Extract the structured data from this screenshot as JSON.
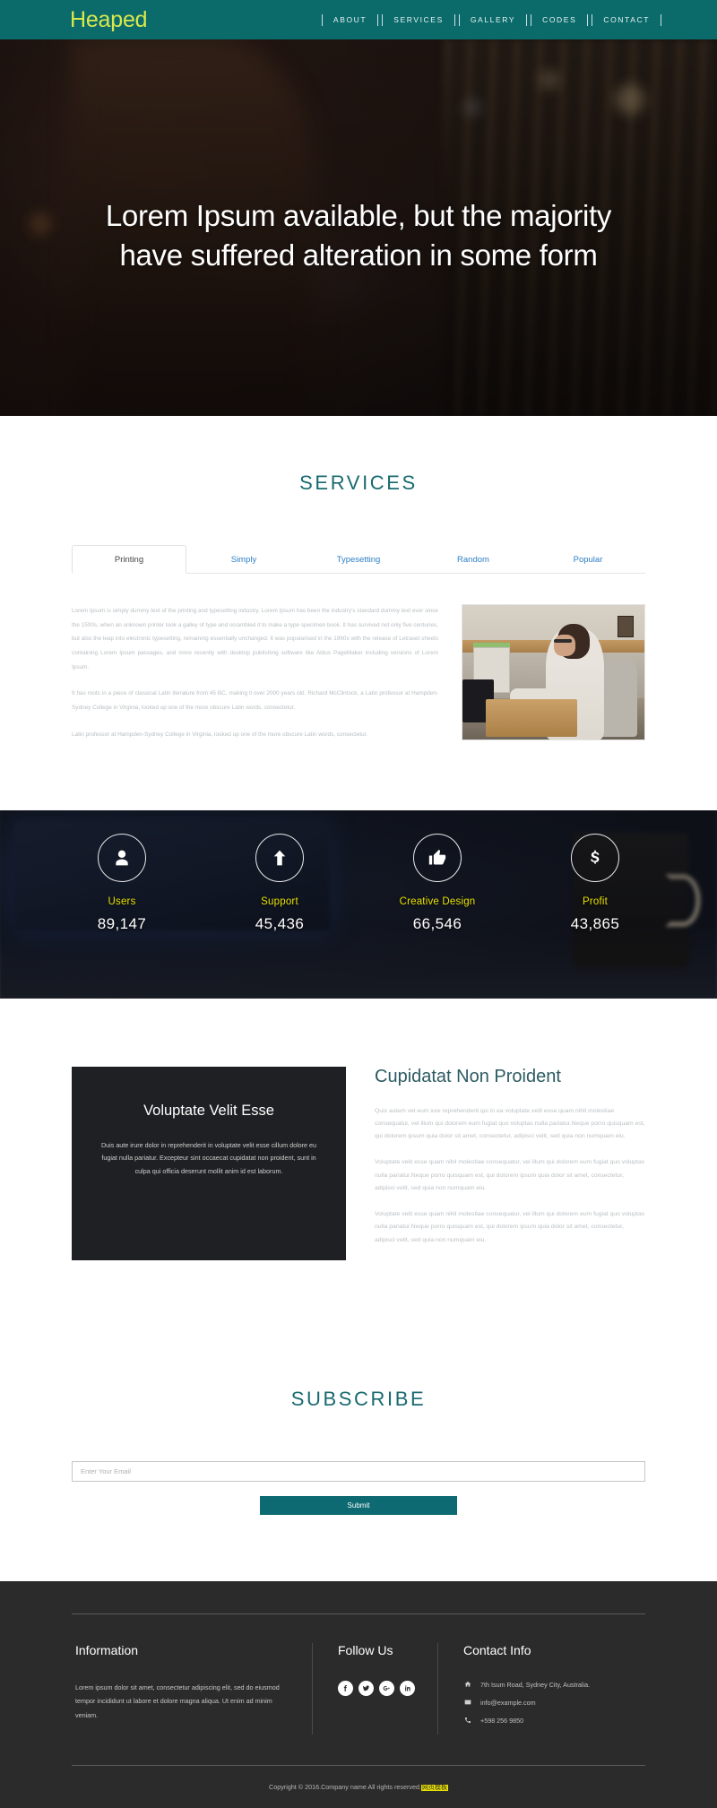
{
  "header": {
    "logo": "Heaped",
    "nav": [
      {
        "label": "ABOUT"
      },
      {
        "label": "SERVICES"
      },
      {
        "label": "GALLERY"
      },
      {
        "label": "CODES"
      },
      {
        "label": "CONTACT"
      }
    ]
  },
  "hero": {
    "title_line1": "Lorem Ipsum available, but the majority",
    "title_line2": "have suffered alteration in some form"
  },
  "services": {
    "title": "SERVICES",
    "tabs": [
      {
        "label": "Printing",
        "active": true
      },
      {
        "label": "Simply",
        "active": false
      },
      {
        "label": "Typesetting",
        "active": false
      },
      {
        "label": "Random",
        "active": false
      },
      {
        "label": "Popular",
        "active": false
      }
    ],
    "paragraphs": [
      "Lorem Ipsum is simply dummy text of the printing and typesetting industry. Lorem Ipsum has been the industry's standard dummy text ever since the 1500s, when an unknown printer took a galley of type and scrambled it to make a type specimen book. It has survived not only five centuries, but also the leap into electronic typesetting, remaining essentially unchanged. It was popularised in the 1960s with the release of Letraset sheets containing Lorem Ipsum passages, and more recently with desktop publishing software like Aldus PageMaker including versions of Lorem Ipsum.",
      "It has roots in a piece of classical Latin literature from 45 BC, making it over 2000 years old. Richard McClintock, a Latin professor at Hampden-Sydney College in Virginia, looked up one of the more obscure Latin words, consectetur.",
      "Latin professor at Hampden-Sydney College in Virginia, looked up one of the more obscure Latin words, consectetur."
    ],
    "image_alt": "man-at-desk-photo"
  },
  "stats": [
    {
      "icon": "user-icon",
      "label": "Users",
      "value": "89,147"
    },
    {
      "icon": "arrow-up-icon",
      "label": "Support",
      "value": "45,436"
    },
    {
      "icon": "thumbs-up-icon",
      "label": "Creative Design",
      "value": "66,546"
    },
    {
      "icon": "dollar-icon",
      "label": "Profit",
      "value": "43,865"
    }
  ],
  "about": {
    "card_title": "Voluptate Velit Esse",
    "card_text": "Duis aute irure dolor in reprehenderit in voluptate velit esse cillum dolore eu fugiat nulla pariatur. Excepteur sint occaecat cupidatat non proident, sunt in culpa qui officia deserunt mollit anim id est laborum.",
    "heading": "Cupidatat Non Proident",
    "paragraphs": [
      "Quis autem vel eum iure reprehenderit qui in ea voluptate velit esse quam nihil molestiae consequatur, vel illum qui dolorem eum fugiat quo voluptas nulla pariatur.Neque porro quisquam est, qui dolorem ipsum quia dolor sit amet, consectetur, adipisci velit, sed quia non numquam eiu.",
      "Voluptate velit esse quam nihil molestiae consequatur, vel illum qui dolorem eum fugiat quo voluptas nulla pariatur.Neque porro quisquam est, qui dolorem ipsum quia dolor sit amet, consectetur, adipisci velit, sed quia non numquam eiu.",
      "Voluptate velit esse quam nihil molestiae consequatur, vel illum qui dolorem eum fugiat quo voluptas nulla pariatur.Neque porro quisquam est, qui dolorem ipsum quia dolor sit amet, consectetur, adipisci velit, sed quia non numquam eiu."
    ]
  },
  "subscribe": {
    "title": "SUBSCRIBE",
    "placeholder": "Enter Your Email",
    "value": "",
    "submit_label": "Submit"
  },
  "footer": {
    "information": {
      "heading": "Information",
      "text": "Lorem ipsum dolor sit amet, consectetur adipiscing elit, sed do eiusmod tempor incididunt ut labore et dolore magna aliqua. Ut enim ad minim veniam."
    },
    "follow": {
      "heading": "Follow Us",
      "socials": [
        {
          "name": "facebook-icon"
        },
        {
          "name": "twitter-icon"
        },
        {
          "name": "google-plus-icon"
        },
        {
          "name": "linkedin-icon"
        }
      ]
    },
    "contact": {
      "heading": "Contact Info",
      "address": "7th Isum Road, Sydney City, Australia.",
      "email": "info@example.com",
      "phone": "+598 256 9850"
    },
    "copyright": "Copyright © 2016.Company name All rights reserved.",
    "copyright_mark": "网页模板"
  },
  "colors": {
    "brand_teal": "#0b6b6b",
    "logo_yellow": "#d9e84a",
    "accent_yellow": "#e8e000",
    "section_title": "#186a6f",
    "tab_link": "#2d7fc4",
    "footer_bg": "#2b2b2b",
    "card_bg": "#1f2023"
  }
}
